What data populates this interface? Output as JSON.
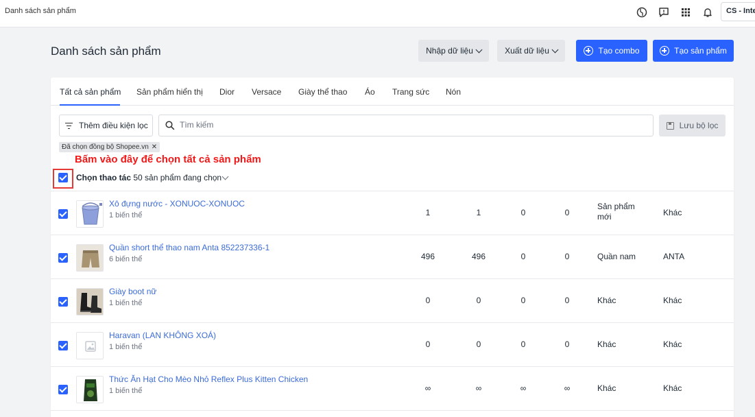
{
  "app": {
    "title": "Danh sách sản phẩm",
    "store_label": "CS - Inter"
  },
  "icons": [
    "globe-icon",
    "chat-icon",
    "apps-grid-icon",
    "bell-icon"
  ],
  "header": {
    "title": "Danh sách sản phẩm",
    "import_label": "Nhập dữ liệu",
    "export_label": "Xuất dữ liệu",
    "create_combo_label": "Tạo combo",
    "create_product_label": "Tạo sản phẩm"
  },
  "tabs": [
    {
      "label": "Tất cả sản phẩm"
    },
    {
      "label": "Sản phẩm hiển thị"
    },
    {
      "label": "Dior"
    },
    {
      "label": "Versace"
    },
    {
      "label": "Giày thể thao"
    },
    {
      "label": "Áo"
    },
    {
      "label": "Trang sức"
    },
    {
      "label": "Nón"
    }
  ],
  "filter": {
    "add_condition_label": "Thêm điều kiện lọc",
    "search_placeholder": "Tìm kiếm",
    "save_label": "Lưu bộ lọc",
    "active_chip": "Đã chọn đồng bộ Shopee.vn"
  },
  "annotation": "Bấm vào đây để chọn tất cả sản phẩm",
  "bulk": {
    "action_label": "Chọn thao tác",
    "selected_text": "50 sản phẩm đang chọn"
  },
  "colors": {
    "primary": "#2962ff",
    "link": "#3b6bd8",
    "annotation": "#f01818"
  },
  "products": [
    {
      "name": "Xô đựng nước - XONUOC-XONUOC",
      "variants": "1 biến thể",
      "c1": "1",
      "c2": "1",
      "c3": "0",
      "c4": "0",
      "type": "Sản phẩm mới",
      "vendor": "Khác",
      "thumb": "bucket"
    },
    {
      "name": "Quần short thể thao nam Anta 852237336-1",
      "variants": "6 biến thể",
      "c1": "496",
      "c2": "496",
      "c3": "0",
      "c4": "0",
      "type": "Quần nam",
      "vendor": "ANTA",
      "thumb": "shorts"
    },
    {
      "name": "Giày boot nữ",
      "variants": "1 biến thể",
      "c1": "0",
      "c2": "0",
      "c3": "0",
      "c4": "0",
      "type": "Khác",
      "vendor": "Khác",
      "thumb": "boots"
    },
    {
      "name": "Haravan (LAN KHÔNG XOÁ)",
      "variants": "1 biến thể",
      "c1": "0",
      "c2": "0",
      "c3": "0",
      "c4": "0",
      "type": "Khác",
      "vendor": "Khác",
      "thumb": "placeholder"
    },
    {
      "name": "Thức Ăn Hạt Cho Mèo Nhỏ Reflex Plus Kitten Chicken",
      "variants": "1 biến thể",
      "c1": "∞",
      "c2": "∞",
      "c3": "∞",
      "c4": "∞",
      "type": "Khác",
      "vendor": "Khác",
      "thumb": "catfood"
    }
  ]
}
